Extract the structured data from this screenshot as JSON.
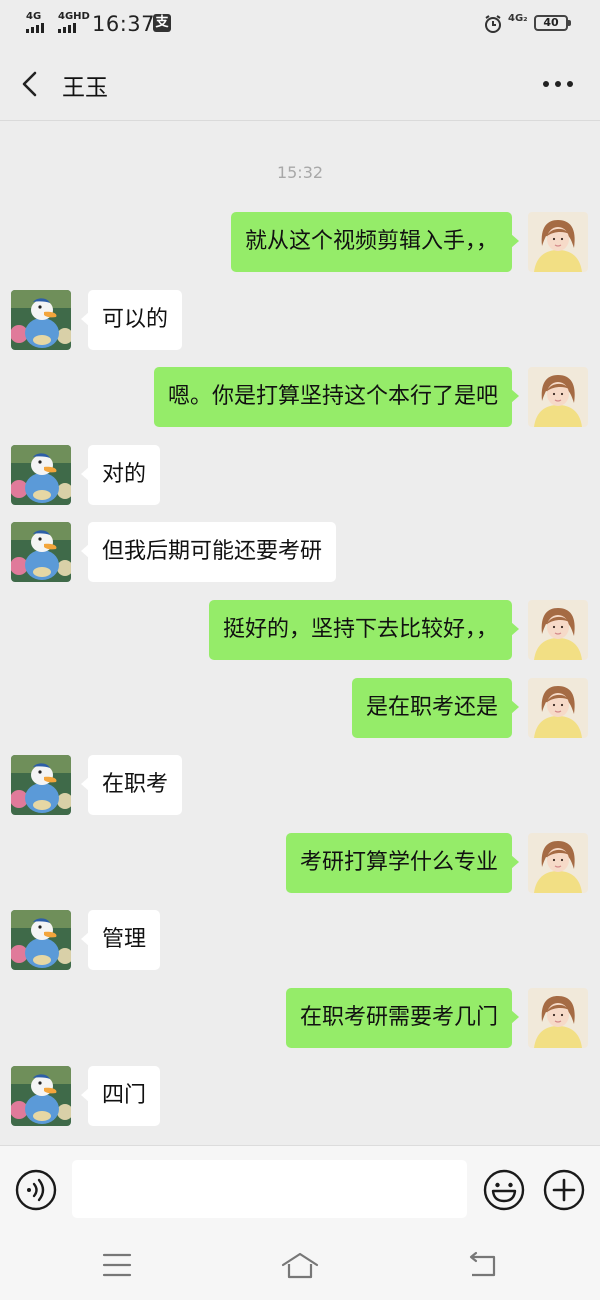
{
  "status_bar": {
    "signal1": "4G",
    "signal2": "4GHD",
    "time": "16:37",
    "pay_icon_char": "支",
    "network_right": "4G₂",
    "battery": "40"
  },
  "header": {
    "title": "王玉",
    "back_icon": "chevron-left-icon",
    "more_icon": "ellipsis-icon"
  },
  "chat": {
    "timestamp": "15:32",
    "messages": [
      {
        "from": "me",
        "text": "就从这个视频剪辑入手，，"
      },
      {
        "from": "other",
        "text": "可以的"
      },
      {
        "from": "me",
        "text": "嗯。你是打算坚持这个本行了是吧"
      },
      {
        "from": "other",
        "text": "对的"
      },
      {
        "from": "other",
        "text": "但我后期可能还要考研"
      },
      {
        "from": "me",
        "text": "挺好的，坚持下去比较好，，"
      },
      {
        "from": "me",
        "text": "是在职考还是"
      },
      {
        "from": "other",
        "text": "在职考"
      },
      {
        "from": "me",
        "text": "考研打算学什么专业"
      },
      {
        "from": "other",
        "text": "管理"
      },
      {
        "from": "me",
        "text": "在职考研需要考几门"
      },
      {
        "from": "other",
        "text": "四门"
      }
    ]
  },
  "input_bar": {
    "placeholder": "",
    "voice_icon": "voice-icon",
    "emoji_icon": "emoji-icon",
    "plus_icon": "plus-icon"
  },
  "system_nav": {
    "menu_icon": "menu-icon",
    "home_icon": "home-icon",
    "back_icon": "return-icon"
  },
  "colors": {
    "background": "#ededed",
    "my_bubble": "#95ec69",
    "other_bubble": "#ffffff",
    "timestamp": "#a8a8a8"
  }
}
